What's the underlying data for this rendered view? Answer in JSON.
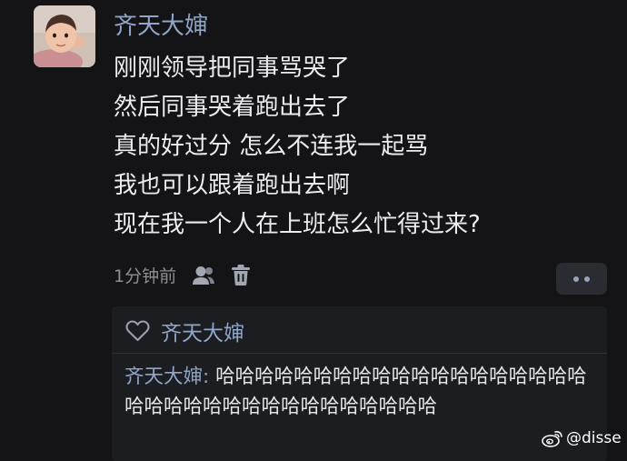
{
  "post": {
    "author": "齐天大婶",
    "lines": [
      "刚刚领导把同事骂哭了",
      "然后同事哭着跑出去了",
      "真的好过分 怎么不连我一起骂",
      "我也可以跟着跑出去啊",
      "现在我一个人在上班怎么忙得过来?"
    ],
    "timestamp": "1分钟前"
  },
  "icons": {
    "user": "user-icon",
    "trash": "trash-icon",
    "more": "more-dots-icon",
    "heart": "heart-outline-icon",
    "weibo": "weibo-logo-icon"
  },
  "reply_panel": {
    "liker": "齐天大婶",
    "comment": {
      "author": "齐天大婶",
      "separator": ": ",
      "text": "哈哈哈哈哈哈哈哈哈哈哈哈哈哈哈哈哈哈哈哈哈哈哈哈哈哈哈哈哈哈哈哈哈哈哈"
    }
  },
  "watermark": {
    "text": "@disse"
  },
  "colors": {
    "background": "#141416",
    "username": "#8fa6c8",
    "body_text": "#ececee",
    "muted": "#8d8d92",
    "panel": "#1c1d21",
    "button": "#2a2c32"
  }
}
